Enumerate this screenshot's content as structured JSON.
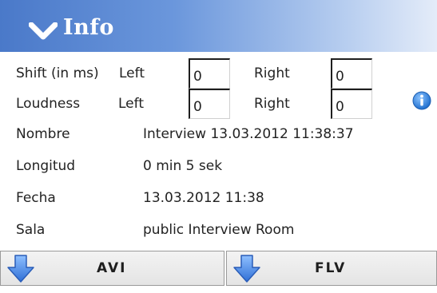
{
  "header": {
    "title": "Info",
    "icon": "chevron-down-icon"
  },
  "shift": {
    "label": "Shift (in ms)",
    "left_label": "Left",
    "left_value": "0",
    "right_label": "Right",
    "right_value": "0"
  },
  "loudness": {
    "label": "Loudness",
    "left_label": "Left",
    "left_value": "0",
    "right_label": "Right",
    "right_value": "0",
    "icon": "info-icon"
  },
  "details": [
    {
      "label": "Nombre",
      "value": "Interview 13.03.2012 11:38:37"
    },
    {
      "label": "Longitud",
      "value": "0 min 5 sek"
    },
    {
      "label": "Fecha",
      "value": "13.03.2012 11:38"
    },
    {
      "label": "Sala",
      "value": "public Interview Room"
    }
  ],
  "downloads": [
    {
      "label": "AVI",
      "icon": "download-arrow-icon"
    },
    {
      "label": "FLV",
      "icon": "download-arrow-icon"
    }
  ],
  "colors": {
    "header_start": "#4a79c9",
    "header_end": "#e4ecf9",
    "arrow": "#3f7fe0",
    "info": "#2c7fd6"
  }
}
